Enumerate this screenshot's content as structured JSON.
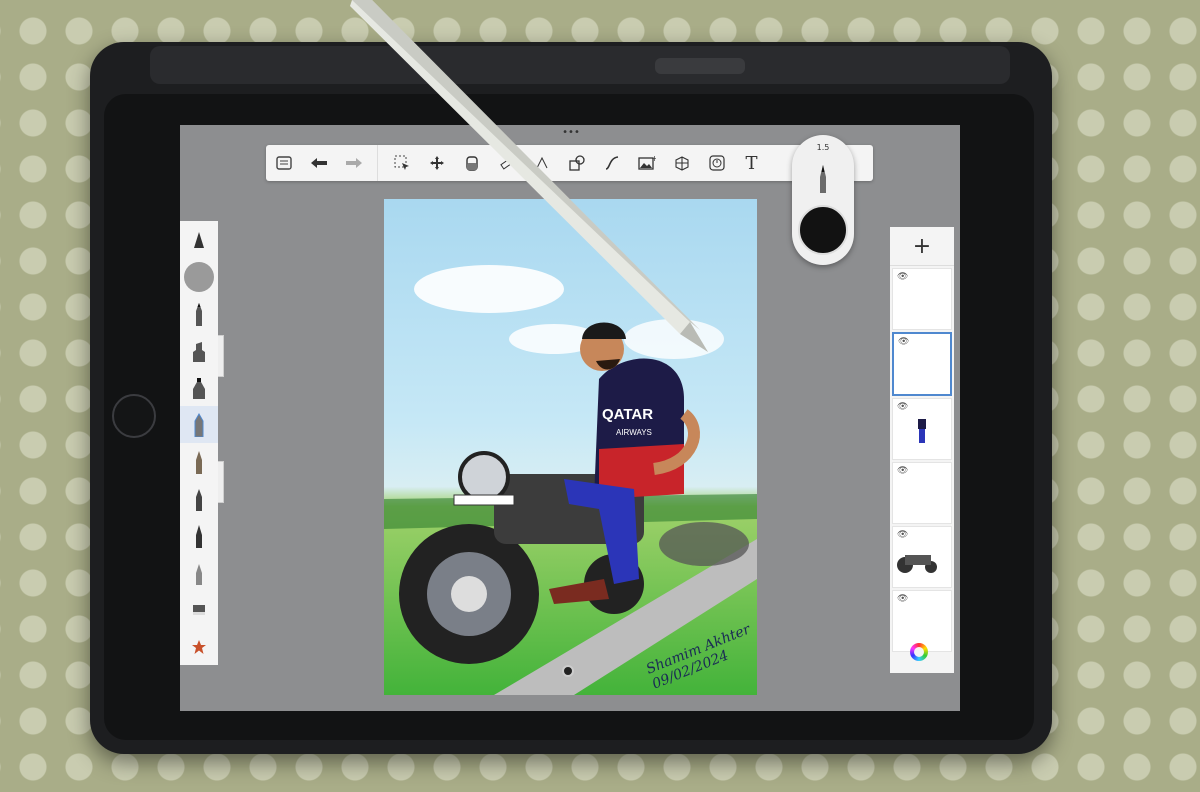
{
  "app": {
    "toolbar": {
      "icons": [
        "list-icon",
        "undo-icon",
        "redo-icon",
        "selection-icon",
        "move-icon",
        "fill-icon",
        "ruler-icon",
        "shape-icon",
        "curve-icon",
        "image-icon",
        "perspective-icon",
        "timelapse-icon",
        "text-icon",
        "symmetry-icon"
      ],
      "text_tool_label": "T"
    },
    "brush_popover": {
      "size": "1.5",
      "color": "#121212"
    },
    "brushes": [
      "cone-brush",
      "round-brush",
      "pencil",
      "marker",
      "airbrush",
      "flat-brush",
      "fountain-pen",
      "brush-tip",
      "ink-pen",
      "fine-liner",
      "eraser",
      "smudge-star"
    ],
    "layers": {
      "add_label": "+",
      "items": [
        {
          "name": "layer-1",
          "visible": true
        },
        {
          "name": "layer-2",
          "visible": true,
          "selected": true
        },
        {
          "name": "layer-3",
          "visible": true
        },
        {
          "name": "layer-4",
          "visible": true
        },
        {
          "name": "layer-5",
          "visible": true
        },
        {
          "name": "layer-6",
          "visible": true
        }
      ]
    }
  },
  "artwork": {
    "jersey_sponsor": "QATAR",
    "jersey_sub": "AIRWAYS",
    "signature_name": "Shamim Akhter",
    "signature_date": "09/02/2024"
  },
  "colors": {
    "accent": "#4f88cf",
    "panel": "#f4f4f4",
    "workspace": "#8d8e90"
  }
}
